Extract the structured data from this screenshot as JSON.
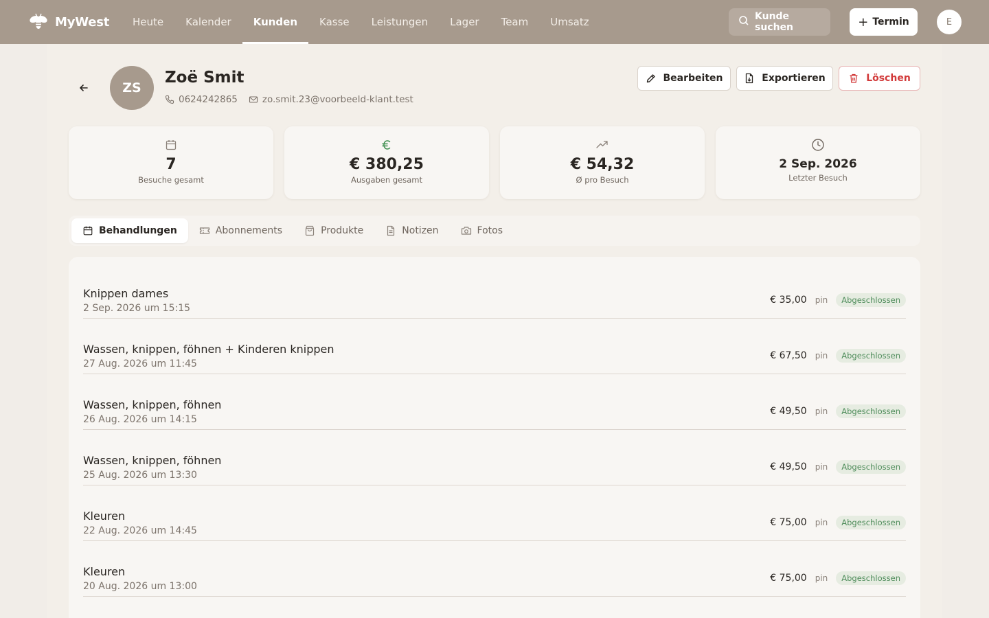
{
  "brand": {
    "name": "MyWest"
  },
  "nav": {
    "items": [
      "Heute",
      "Kalender",
      "Kunden",
      "Kasse",
      "Leistungen",
      "Lager",
      "Team",
      "Umsatz"
    ],
    "active": "Kunden"
  },
  "topbar": {
    "search_label": "Kunde suchen",
    "new_label": "Termin",
    "user_initial": "E"
  },
  "customer": {
    "initials": "ZS",
    "name": "Zoë Smit",
    "phone": "0624242865",
    "email": "zo.smit.23@voorbeeld-klant.test"
  },
  "actions": {
    "edit": "Bearbeiten",
    "export": "Exportieren",
    "delete": "Löschen"
  },
  "stats": [
    {
      "icon": "calendar-icon",
      "value": "7",
      "label": "Besuche gesamt"
    },
    {
      "icon": "euro-icon",
      "value": "€ 380,25",
      "label": "Ausgaben gesamt"
    },
    {
      "icon": "trending-up-icon",
      "value": "€ 54,32",
      "label": "Ø pro Besuch"
    },
    {
      "icon": "clock-icon",
      "value": "2 Sep. 2026",
      "label": "Letzter Besuch"
    }
  ],
  "tabs": [
    {
      "icon": "calendar-icon",
      "label": "Behandlungen",
      "active": true
    },
    {
      "icon": "ticket-icon",
      "label": "Abonnements",
      "active": false
    },
    {
      "icon": "bag-icon",
      "label": "Produkte",
      "active": false
    },
    {
      "icon": "note-icon",
      "label": "Notizen",
      "active": false
    },
    {
      "icon": "camera-icon",
      "label": "Fotos",
      "active": false
    }
  ],
  "treatments": [
    {
      "title": "Knippen dames",
      "date": "2 Sep. 2026 um 15:15",
      "price": "€ 35,00",
      "payment": "pin",
      "status": "Abgeschlossen"
    },
    {
      "title": "Wassen, knippen, föhnen + Kinderen knippen",
      "date": "27 Aug. 2026 um 11:45",
      "price": "€ 67,50",
      "payment": "pin",
      "status": "Abgeschlossen"
    },
    {
      "title": "Wassen, knippen, föhnen",
      "date": "26 Aug. 2026 um 14:15",
      "price": "€ 49,50",
      "payment": "pin",
      "status": "Abgeschlossen"
    },
    {
      "title": "Wassen, knippen, föhnen",
      "date": "25 Aug. 2026 um 13:30",
      "price": "€ 49,50",
      "payment": "pin",
      "status": "Abgeschlossen"
    },
    {
      "title": "Kleuren",
      "date": "22 Aug. 2026 um 14:45",
      "price": "€ 75,00",
      "payment": "pin",
      "status": "Abgeschlossen"
    },
    {
      "title": "Kleuren",
      "date": "20 Aug. 2026 um 13:00",
      "price": "€ 75,00",
      "payment": "pin",
      "status": "Abgeschlossen"
    }
  ],
  "colors": {
    "topbar": "#a79a8d",
    "delete": "#d23a3a",
    "success": "#4e8c5a",
    "euro_icon": "#3f8f4f"
  }
}
